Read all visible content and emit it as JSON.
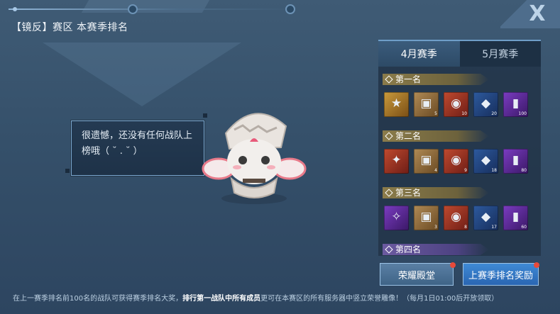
{
  "header": {
    "title": "【镜反】赛区 本赛季排名"
  },
  "close": {
    "label": "X"
  },
  "bubble": {
    "text": "很遗憾，还没有任何战队上榜哦（ ˘ . ˘ ）"
  },
  "tabs": [
    {
      "label": "4月赛季",
      "active": true
    },
    {
      "label": "5月赛季",
      "active": false
    }
  ],
  "ranks": [
    {
      "title": "第一名",
      "items": [
        {
          "icon": "gold-medal-icon",
          "count": ""
        },
        {
          "icon": "crate-icon",
          "count": "5"
        },
        {
          "icon": "robot-chest-icon",
          "count": "10"
        },
        {
          "icon": "gold-ingot-icon",
          "count": "20"
        },
        {
          "icon": "purple-card-icon",
          "count": "100"
        }
      ]
    },
    {
      "title": "第二名",
      "items": [
        {
          "icon": "silver-medal-icon",
          "count": ""
        },
        {
          "icon": "crate-icon",
          "count": "4"
        },
        {
          "icon": "robot-chest-icon",
          "count": "9"
        },
        {
          "icon": "gold-ingot-icon",
          "count": "18"
        },
        {
          "icon": "purple-card-icon",
          "count": "80"
        }
      ]
    },
    {
      "title": "第三名",
      "items": [
        {
          "icon": "pink-medal-icon",
          "count": ""
        },
        {
          "icon": "crate-icon",
          "count": "3"
        },
        {
          "icon": "robot-chest-icon",
          "count": "8"
        },
        {
          "icon": "gold-ingot-icon",
          "count": "17"
        },
        {
          "icon": "purple-card-icon",
          "count": "60"
        }
      ]
    },
    {
      "title": "第四名",
      "items": []
    }
  ],
  "buttons": {
    "hall": "荣耀殿堂",
    "last_rewards": "上赛季排名奖励"
  },
  "footer": {
    "part1": "在上一赛季排名前100名的战队可获得赛季排名大奖，",
    "part2": "排行第一战队中所有成员",
    "part3": "更可在本赛区的所有服务器中竖立荣誉雕像！（每月1日01:00后开放领取）"
  }
}
